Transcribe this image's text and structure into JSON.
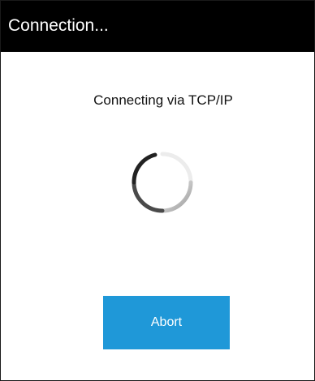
{
  "window": {
    "title": "Connection..."
  },
  "dialog": {
    "status": "Connecting via TCP/IP",
    "spinner_icon": "loading-spinner-icon",
    "abort_label": "Abort"
  },
  "colors": {
    "titlebar": "#000000",
    "title_text": "#ffffff",
    "button": "#1f98d8",
    "button_text": "#ffffff",
    "spinner_dark": "#303030",
    "spinner_light": "#e6e6e6"
  }
}
